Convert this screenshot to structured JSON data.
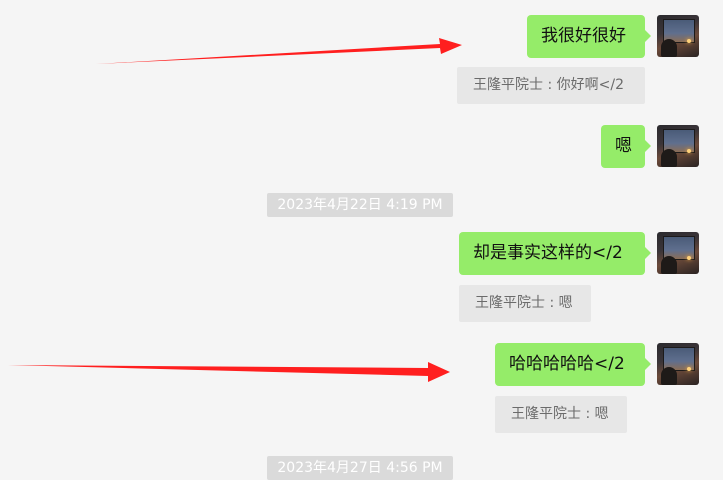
{
  "messages": [
    {
      "text": "我很好很好",
      "quote": "王隆平院士 : 你好啊</2"
    },
    {
      "text": "嗯",
      "quote": ""
    },
    {
      "text": "却是事实这样的</2",
      "quote": "王隆平院士 : 嗯"
    },
    {
      "text": "哈哈哈哈哈</2",
      "quote": "王隆平院士 : 嗯"
    }
  ],
  "timestamps": [
    "2023年4月22日 4:19 PM",
    "2023年4月27日 4:56 PM"
  ],
  "colors": {
    "bubble": "#95ec69",
    "quote_bg": "#e7e7e7",
    "arrow": "#ff1f1f",
    "background": "#f5f5f5"
  },
  "icons": {
    "avatar": "user-avatar-photo",
    "annotation": "red-arrow"
  }
}
